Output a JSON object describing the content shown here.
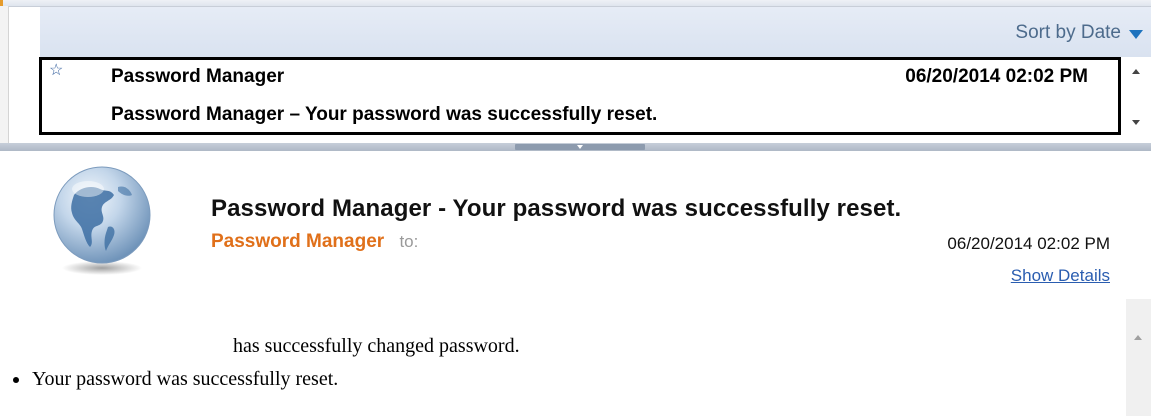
{
  "list": {
    "sort_label": "Sort by Date",
    "message": {
      "sender": "Password Manager",
      "date": "06/20/2014 02:02 PM",
      "subject": "Password Manager – Your password was successfully reset."
    }
  },
  "reader": {
    "title": "Password Manager - Your password was successfully reset.",
    "from_name": "Password Manager",
    "to_label": "to:",
    "date": "06/20/2014 02:02 PM",
    "show_details": "Show Details",
    "body_line": "has successfully changed password.",
    "bullet": "Your password was successfully reset."
  },
  "colors": {
    "sender_accent": "#e0701a",
    "link": "#2a5db0",
    "sort_text": "#4d6b8c"
  },
  "icons": [
    "star-icon",
    "sort-arrow-icon",
    "globe-icon",
    "scroll-up-icon",
    "scroll-down-icon"
  ]
}
